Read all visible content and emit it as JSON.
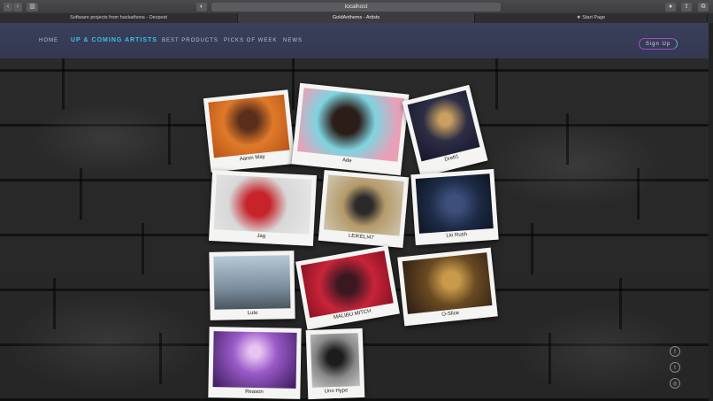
{
  "browser": {
    "address": "localhost",
    "tabs": [
      {
        "label": "Software projects from hackathons - Devpost"
      },
      {
        "label": "GoldAnthems - Artists"
      },
      {
        "label": "Start Page"
      }
    ]
  },
  "nav": {
    "items": [
      "HOME",
      "UP & COMING ARTISTS",
      "BEST PRODUCTS",
      "PICKS OF WEEK",
      "NEWS"
    ],
    "signup": "Sign Up"
  },
  "artists": [
    {
      "name": "Aaron May"
    },
    {
      "name": "Ade"
    },
    {
      "name": "Drett1"
    },
    {
      "name": "Jag"
    },
    {
      "name": "LEIKELI47"
    },
    {
      "name": "Lio Rush"
    },
    {
      "name": "Lute"
    },
    {
      "name": "MALIBU MITCH"
    },
    {
      "name": "O-Slice"
    },
    {
      "name": "Reason"
    },
    {
      "name": "Uno Hype"
    }
  ],
  "social": [
    "facebook-icon",
    "twitter-icon",
    "instagram-icon"
  ]
}
